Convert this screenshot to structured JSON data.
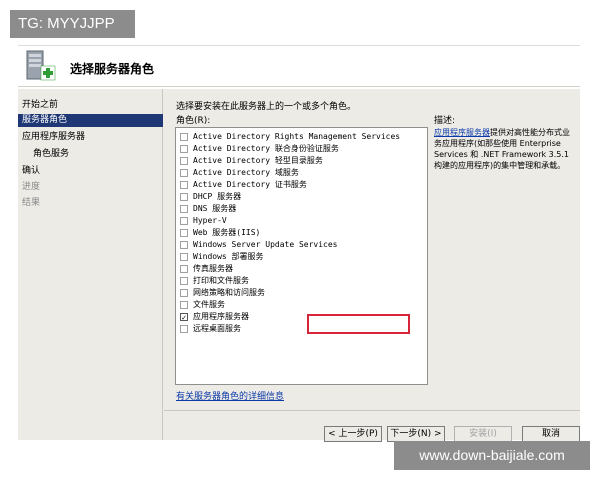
{
  "watermark_top": "TG: MYYJJPP",
  "watermark_bottom": "www.down-baijiale.com",
  "header": {
    "title": "选择服务器角色",
    "icon": "server-roles-icon"
  },
  "nav": {
    "items": [
      {
        "label": "开始之前",
        "state": "normal"
      },
      {
        "label": "服务器角色",
        "state": "selected"
      },
      {
        "label": "应用程序服务器",
        "state": "normal"
      },
      {
        "label": "角色服务",
        "state": "normal"
      },
      {
        "label": "确认",
        "state": "normal"
      },
      {
        "label": "进度",
        "state": "disabled"
      },
      {
        "label": "结果",
        "state": "disabled"
      }
    ]
  },
  "main": {
    "instruction": "选择要安装在此服务器上的一个或多个角色。",
    "roles_label": "角色(R):",
    "roles": [
      {
        "label": "Active Directory Rights Management Services",
        "checked": false
      },
      {
        "label": "Active Directory 联合身份验证服务",
        "checked": false
      },
      {
        "label": "Active Directory 轻型目录服务",
        "checked": false
      },
      {
        "label": "Active Directory 域服务",
        "checked": false
      },
      {
        "label": "Active Directory 证书服务",
        "checked": false
      },
      {
        "label": "DHCP 服务器",
        "checked": false
      },
      {
        "label": "DNS 服务器",
        "checked": false
      },
      {
        "label": "Hyper-V",
        "checked": false
      },
      {
        "label": "Web 服务器(IIS)",
        "checked": false
      },
      {
        "label": "Windows Server Update Services",
        "checked": false
      },
      {
        "label": "Windows 部署服务",
        "checked": false
      },
      {
        "label": "传真服务器",
        "checked": false
      },
      {
        "label": "打印和文件服务",
        "checked": false
      },
      {
        "label": "网络策略和访问服务",
        "checked": false
      },
      {
        "label": "文件服务",
        "checked": false
      },
      {
        "label": "应用程序服务器",
        "checked": true
      },
      {
        "label": "远程桌面服务",
        "checked": false
      }
    ],
    "more_info_link": "有关服务器角色的详细信息",
    "description": {
      "title": "描述:",
      "link_text": "应用程序服务器",
      "body": "提供对高性能分布式业务应用程序(如那些使用 Enterprise Services 和 .NET Framework 3.5.1 构建的应用程序)的集中管理和承载。"
    }
  },
  "buttons": {
    "back": "< 上一步(P)",
    "next": "下一步(N) >",
    "install": "安装(I)",
    "cancel": "取消"
  },
  "colors": {
    "selected_nav_bg": "#1f3875",
    "highlight_border": "#d6243a",
    "link": "#0b3aa8"
  }
}
